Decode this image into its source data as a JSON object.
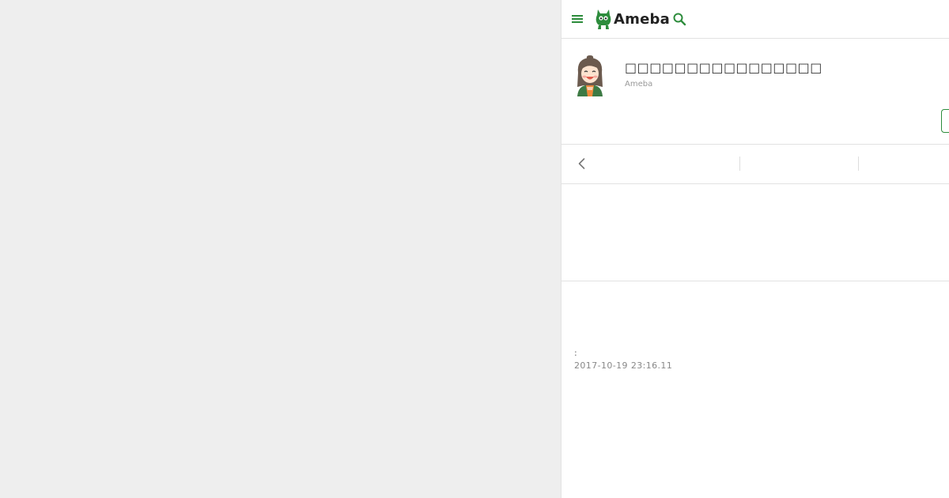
{
  "header": {
    "logo_text": "Ameba",
    "menu_icon": "hamburger-menu-icon",
    "search_icon": "search-icon",
    "accent_color": "#2d8c3c"
  },
  "profile": {
    "title": "□□□□□□□□□□□□□□□□",
    "subtitle": "Ameba"
  },
  "article": {
    "meta_colon": ":",
    "date": "2017-10-19 23:16.11"
  }
}
